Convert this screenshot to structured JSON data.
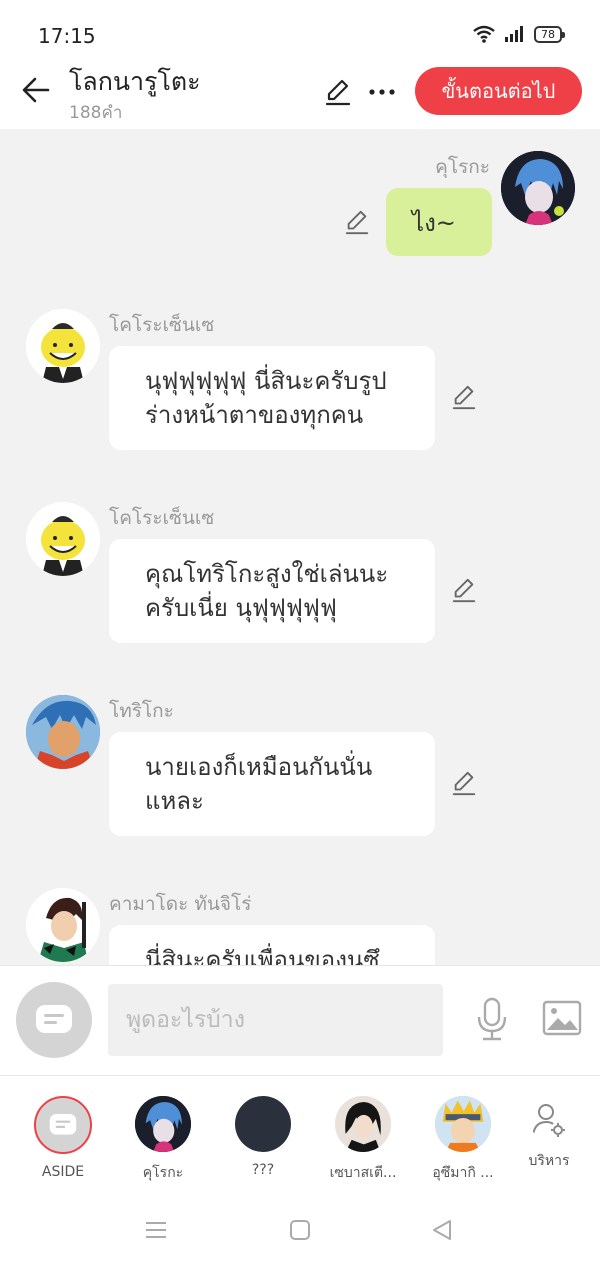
{
  "status_bar": {
    "time": "17:15",
    "battery": "78"
  },
  "header": {
    "title": "โลกนารูโตะ",
    "word_count": "188คำ",
    "next_label": "ขั้นตอนต่อไป"
  },
  "messages": [
    {
      "sender": "คุโรกะ",
      "text": "ไง~",
      "mine": true
    },
    {
      "sender": "โคโระเซ็นเซ",
      "line1": "นุฟุฟุฟุฟุฟุ นี่สินะครับรูป",
      "line2": "ร่างหน้าตาของทุกคน"
    },
    {
      "sender": "โคโระเซ็นเซ",
      "line1": "คุณโทริโกะสูงใช่เล่นนะ",
      "line2": "ครับเนี่ย นุฟุฟุฟุฟุฟุ"
    },
    {
      "sender": "โทริโกะ",
      "line1": "นายเองก็เหมือนกันนั่น",
      "line2": "แหละ"
    },
    {
      "sender": "คามาโดะ ทันจิโร่",
      "line1": "นี่สินะครับเพื่อนของนูซึ"
    }
  ],
  "input": {
    "placeholder": "พูดอะไรบ้าง"
  },
  "characters": [
    {
      "label": "ASIDE"
    },
    {
      "label": "คุโรกะ"
    },
    {
      "label": "???"
    },
    {
      "label": "เซบาสเตี..."
    },
    {
      "label": "อุซึมากิ ..."
    },
    {
      "label": "บริหาร"
    }
  ],
  "colors": {
    "accent": "#f04047",
    "my_bubble": "#d8f09a",
    "background": "#f2f2f2"
  }
}
